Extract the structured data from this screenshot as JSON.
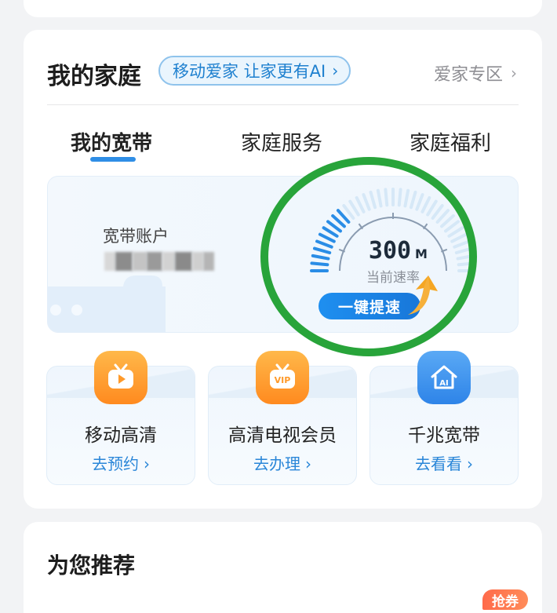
{
  "family": {
    "title": "我的家庭",
    "slogan": "移动爱家 让家更有AI",
    "slogan_chevron": "›",
    "zone_link": "爱家专区",
    "zone_chevron": "›"
  },
  "tabs": [
    {
      "label": "我的宽带",
      "active": true
    },
    {
      "label": "家庭服务",
      "active": false
    },
    {
      "label": "家庭福利",
      "active": false
    }
  ],
  "broadband": {
    "account_label": "宽带账户",
    "speed_value": "300",
    "speed_unit": "M",
    "speed_caption": "当前速率",
    "boost_button": "一键提速"
  },
  "services": [
    {
      "title": "移动高清",
      "action": "去预约",
      "icon": "tv-play-icon",
      "chevron": "›"
    },
    {
      "title": "高清电视会员",
      "action": "去办理",
      "icon": "tv-vip-icon",
      "chevron": "›"
    },
    {
      "title": "千兆宽带",
      "action": "去看看",
      "icon": "home-ai-icon",
      "chevron": "›"
    }
  ],
  "recommend": {
    "title": "为您推荐",
    "badge": "抢券"
  },
  "colors": {
    "accent": "#2f8ee6",
    "highlight_ring": "#28a43a",
    "service_orange": "#ff9a2a",
    "coupon_red": "#ff6a4a"
  }
}
